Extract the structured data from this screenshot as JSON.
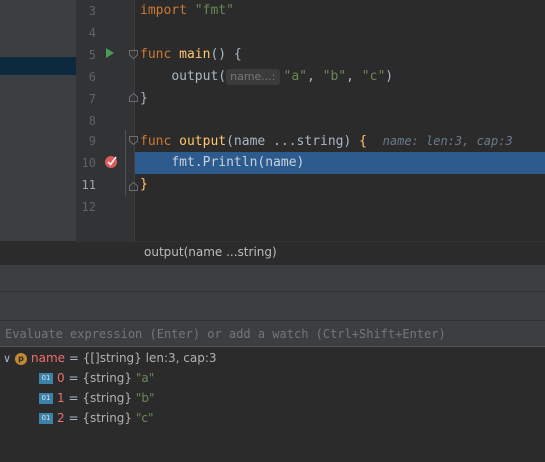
{
  "editor": {
    "line_numbers": [
      "3",
      "4",
      "5",
      "6",
      "7",
      "8",
      "9",
      "10",
      "11",
      "12"
    ],
    "lines": {
      "l3": {
        "kw": "import",
        "str": "\"fmt\""
      },
      "l5": {
        "kw": "func",
        "name": "main",
        "rest": "() {"
      },
      "l6": {
        "call": "output(",
        "hint": "name...:",
        "args_a": "\"a\"",
        "sep1": ", ",
        "args_b": "\"b\"",
        "sep2": ", ",
        "args_c": "\"c\"",
        "close": ")"
      },
      "l7": {
        "text": "}"
      },
      "l9": {
        "kw": "func",
        "name": "output",
        "params": "(name ...string) ",
        "brace": "{",
        "inline_value": "name: len:3, cap:3"
      },
      "l10": {
        "text": "fmt.Println(name)"
      },
      "l11": {
        "text": "}"
      }
    }
  },
  "breadcrumb": {
    "label": "output(name ...string)"
  },
  "evaluate": {
    "placeholder": "Evaluate expression (Enter) or add a watch (Ctrl+Shift+Enter)"
  },
  "variables": {
    "root": {
      "badge": "p",
      "name": "name",
      "eq": " = ",
      "type": "{[]string}",
      "value": " len:3, cap:3"
    },
    "children": [
      {
        "badge": "01",
        "name": "0",
        "eq": " = ",
        "type": "{string} ",
        "value": "\"a\""
      },
      {
        "badge": "01",
        "name": "1",
        "eq": " = ",
        "type": "{string} ",
        "value": "\"b\""
      },
      {
        "badge": "01",
        "name": "2",
        "eq": " = ",
        "type": "{string} ",
        "value": "\"c\""
      }
    ]
  },
  "icons": {
    "run": "run-gutter-icon",
    "breakpoint": "breakpoint-check-icon",
    "fold": "fold-marker-icon",
    "expand": "chevron-down-icon"
  },
  "colors": {
    "exec_line": "#2d5b8e",
    "keyword": "#cc7832",
    "string": "#6a8759",
    "function": "#ffc66d",
    "breakpoint": "#db5c5c"
  }
}
